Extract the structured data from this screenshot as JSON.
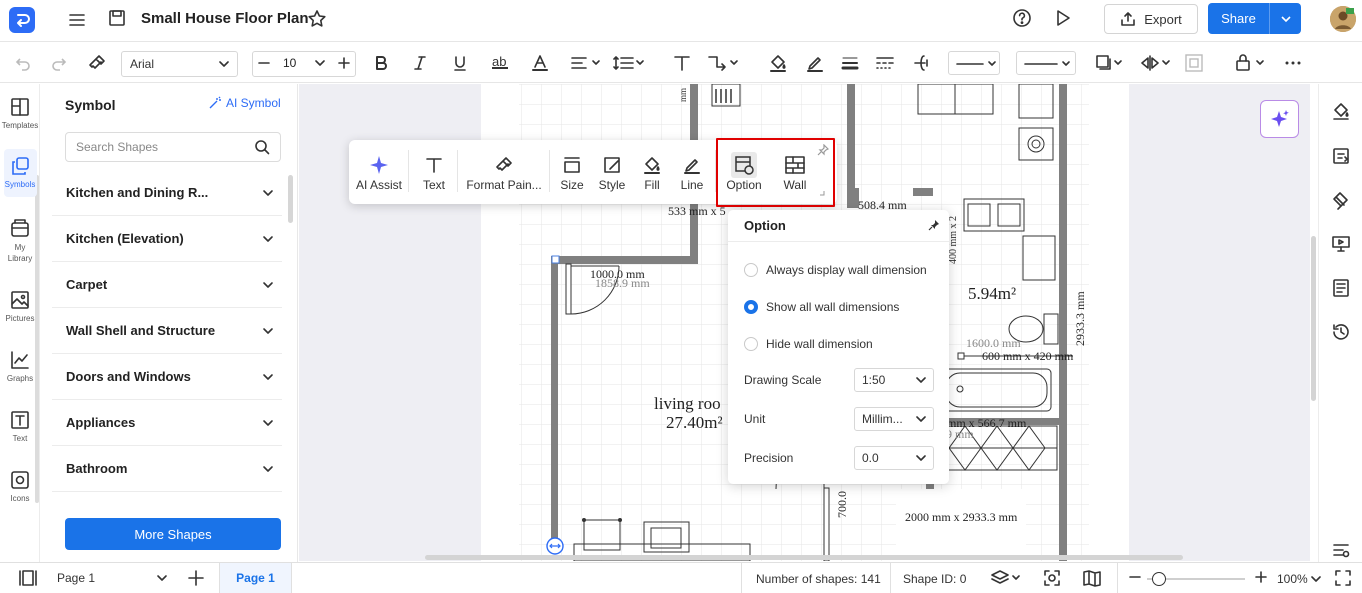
{
  "app": {
    "title": "Small House Floor Plan"
  },
  "header": {
    "export_label": "Export",
    "share_label": "Share"
  },
  "format_toolbar": {
    "font": "Arial",
    "font_size": "10"
  },
  "left_rail": {
    "items": [
      "Templates",
      "Symbols",
      "My Library",
      "Pictures",
      "Graphs",
      "Text",
      "Icons"
    ]
  },
  "symbol_panel": {
    "title": "Symbol",
    "ai_symbol": "AI Symbol",
    "search_placeholder": "Search Shapes",
    "categories": [
      "Kitchen and Dining R...",
      "Kitchen (Elevation)",
      "Carpet",
      "Wall Shell and Structure",
      "Doors and Windows",
      "Appliances",
      "Bathroom"
    ],
    "more_shapes": "More Shapes"
  },
  "floating_toolbar": {
    "items": [
      "AI Assist",
      "Text",
      "Format Pain...",
      "Size",
      "Style",
      "Fill",
      "Line",
      "Option",
      "Wall"
    ]
  },
  "option_popup": {
    "title": "Option",
    "radios": [
      {
        "label": "Always display wall dimension",
        "checked": false
      },
      {
        "label": "Show all wall dimensions",
        "checked": true
      },
      {
        "label": "Hide wall dimension",
        "checked": false
      }
    ],
    "fields": [
      {
        "label": "Drawing Scale",
        "value": "1:50"
      },
      {
        "label": "Unit",
        "value": "Millim..."
      },
      {
        "label": "Precision",
        "value": "0.0"
      }
    ]
  },
  "floor_plan": {
    "labels": {
      "dim_top_left": "533 mm x 5",
      "dim_top_right": "508.4 mm",
      "dim_1000": "1000.0 mm",
      "dim_1858": "1858.9 mm",
      "living_room": "living roo",
      "living_area": "27.40m²",
      "bath_area": "5.94m²",
      "dim_1600": "1600.0 mm",
      "dim_600": "600 mm x 420 mm",
      "dim_2933_v": "2933.3 mm",
      "dim_400": "400 mm x 2",
      "dim_700": "700.0",
      "dim_566": "mm x 566.7 mm",
      "dim_9mm": "9 mm",
      "dim_2000": "2000 mm x 2933.3 mm"
    }
  },
  "status_bar": {
    "page_select": "Page 1",
    "page_tab": "Page 1",
    "shapes": "Number of shapes: 141",
    "shape_id": "Shape ID: 0",
    "zoom": "100%"
  },
  "colors": {
    "accent": "#1a73e8",
    "highlight": "#e00000",
    "wall": "#808080"
  }
}
